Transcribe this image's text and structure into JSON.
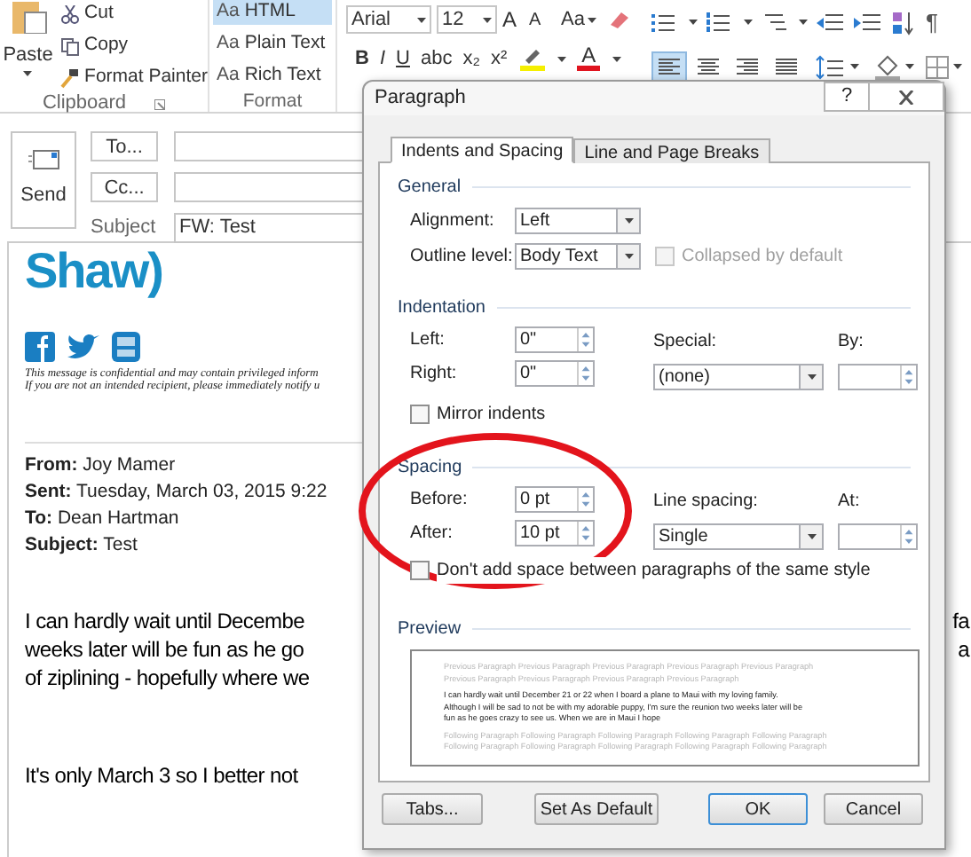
{
  "ribbon": {
    "clipboard": {
      "paste": "Paste",
      "items": [
        "Cut",
        "Copy",
        "Format Painter"
      ],
      "label": "Clipboard"
    },
    "format": {
      "items": [
        {
          "prefix": "Aa",
          "label": "HTML",
          "selected": true
        },
        {
          "prefix": "Aa",
          "label": "Plain Text",
          "selected": false
        },
        {
          "prefix": "Aa",
          "label": "Rich Text",
          "selected": false
        }
      ],
      "label": "Format"
    },
    "font": {
      "name": "Arial",
      "size": "12",
      "grow": "A",
      "shrink": "A",
      "change_case": "Aa",
      "styles": [
        "B",
        "I",
        "U",
        "abc",
        "x₂",
        "x²"
      ],
      "font_color": "A"
    },
    "alignment": [
      {
        "kind": "left",
        "selected": true
      },
      {
        "kind": "center",
        "selected": false
      },
      {
        "kind": "right",
        "selected": false
      },
      {
        "kind": "justify",
        "selected": false
      }
    ],
    "pilcrow": "¶"
  },
  "header": {
    "send": "Send",
    "to_button": "To...",
    "cc_button": "Cc...",
    "subject_label": "Subject",
    "subject": "FW: Test"
  },
  "message": {
    "logo": "Shaw)",
    "disclaimer": [
      "This message is confidential and may contain privileged inform",
      "If you are not an intended recipient, please immediately notify u"
    ],
    "fields": [
      {
        "label": "From:",
        "value": "Joy Mamer"
      },
      {
        "label": "Sent:",
        "value": "Tuesday, March 03, 2015 9:22"
      },
      {
        "label": "To:",
        "value": "Dean Hartman"
      },
      {
        "label": "Subject:",
        "value": "Test"
      }
    ],
    "paragraph_lines": [
      {
        "left": "I can hardly wait until Decembe",
        "right": "fa"
      },
      {
        "left": "weeks later will be fun as he go",
        "right": "a"
      },
      {
        "left": "of ziplining - hopefully where we"
      }
    ],
    "closing": "It's only March 3 so I better not"
  },
  "dialog": {
    "title": "Paragraph",
    "help": "?",
    "tabs": [
      {
        "label": "Indents and Spacing",
        "selected": true
      },
      {
        "label": "Line and Page Breaks",
        "selected": false
      }
    ],
    "general": {
      "heading": "General",
      "alignment": {
        "label": "Alignment:",
        "value": "Left"
      },
      "outline": {
        "label": "Outline level:",
        "value": "Body Text"
      },
      "collapsed": {
        "label": "Collapsed by default",
        "checked": false,
        "disabled": true
      }
    },
    "indentation": {
      "heading": "Indentation",
      "left": {
        "label": "Left:",
        "value": "0\""
      },
      "right": {
        "label": "Right:",
        "value": "0\""
      },
      "special": {
        "label": "Special:",
        "value": "(none)"
      },
      "by": {
        "label": "By:"
      },
      "mirror": {
        "label": "Mirror indents",
        "checked": false
      }
    },
    "spacing": {
      "heading": "Spacing",
      "before": {
        "label": "Before:",
        "value": "0 pt"
      },
      "after": {
        "label": "After:",
        "value": "10 pt"
      },
      "line_spacing": {
        "label": "Line spacing:",
        "value": "Single"
      },
      "at": {
        "label": "At:"
      },
      "dont_add": {
        "label": "Don't add space between paragraphs of the same style",
        "checked": false
      }
    },
    "preview": {
      "heading": "Preview",
      "previous": [
        "Previous Paragraph Previous Paragraph Previous Paragraph Previous Paragraph Previous Paragraph",
        "Previous Paragraph Previous Paragraph Previous Paragraph Previous Paragraph"
      ],
      "sample": [
        "I can hardly wait until December 21 or 22 when I board a plane to Maui with my loving family.",
        "Although I will be sad to not be with my adorable puppy, I'm sure the reunion two weeks later will be",
        "fun as he goes crazy to see us. When we are in Maui I hope"
      ],
      "following": [
        "Following Paragraph Following Paragraph Following Paragraph Following Paragraph Following Paragraph",
        "Following Paragraph Following Paragraph Following Paragraph Following Paragraph Following Paragraph"
      ]
    },
    "buttons": [
      {
        "label": "Tabs...",
        "default": false
      },
      {
        "label": "Set As Default",
        "default": false
      },
      {
        "label": "OK",
        "default": true
      },
      {
        "label": "Cancel",
        "default": false
      }
    ]
  }
}
